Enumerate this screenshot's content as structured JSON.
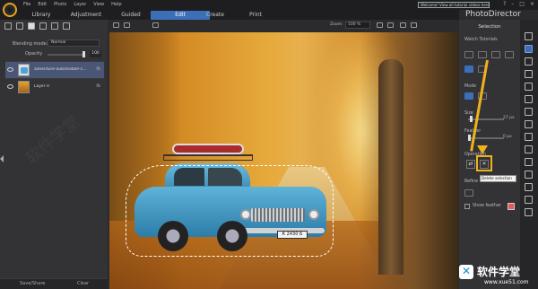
{
  "titlebar": {
    "menu": [
      "File",
      "Edit",
      "Photo",
      "Layer",
      "View",
      "Help"
    ],
    "welcome": "Welcome! View all tutorial videos here!",
    "buttons": [
      "?",
      "–",
      "□",
      "×"
    ]
  },
  "tabs": [
    "Library",
    "Adjustment",
    "Guided",
    "Edit",
    "Create",
    "Print"
  ],
  "active_tab": "Edit",
  "app_name": "PhotoDirector",
  "left_panel": {
    "blending_label": "Blending mode:",
    "blending_value": "Normal",
    "opacity_label": "Opacity",
    "opacity_value": "100",
    "opacity_fraction": 1.0,
    "layers": [
      {
        "name": "adventure-automobile-c...",
        "fx": "fx",
        "selected": true
      },
      {
        "name": "Layer 0",
        "fx": "fx",
        "selected": false
      }
    ],
    "save_share": "Save/Share",
    "clear": "Clear",
    "watermark": "软件学堂"
  },
  "canvas_toolbar": {
    "zoom_label": "Zoom:",
    "zoom_value": "100 %"
  },
  "canvas": {
    "plate_text": "К 2430 Б"
  },
  "right_panel": {
    "title": "Selection",
    "watch_tutorials": "Watch Tutorials",
    "mode_label": "Mode",
    "size_label": "Size",
    "size_value": "27 px",
    "feather_label": "Feather",
    "feather_value": "0 px",
    "operation_label": "Operation",
    "tooltip": "Delete selection",
    "refine_label": "Refine",
    "show_feather": "Show feather",
    "accent": "#3d6fb8",
    "highlight": "#f0b21c"
  },
  "brand": {
    "name": "软件学堂",
    "url": "www.xue51.com"
  }
}
